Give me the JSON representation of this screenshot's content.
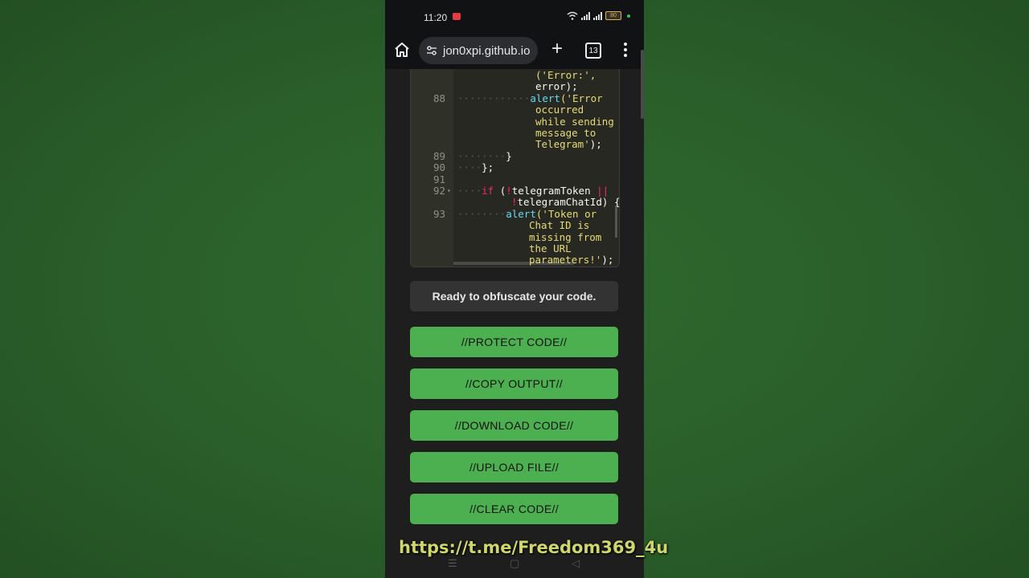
{
  "statusbar": {
    "time": "11:20",
    "battery": "80"
  },
  "browser": {
    "url": "jon0xpi.github.io",
    "tab_count": "13"
  },
  "editor": {
    "lines": [
      {
        "num": "",
        "dots": "",
        "segments": [
          {
            "cls": "str",
            "text": "('Error:',"
          }
        ]
      },
      {
        "num": "",
        "dots": "",
        "segments": [
          {
            "cls": "tx",
            "text": "error);"
          }
        ]
      },
      {
        "num": "88",
        "dots": "············",
        "segments": [
          {
            "cls": "fn",
            "text": "alert"
          },
          {
            "cls": "str",
            "text": "('Error"
          }
        ]
      },
      {
        "num": "",
        "dots": "",
        "segments": [
          {
            "cls": "str",
            "text": "occurred"
          }
        ]
      },
      {
        "num": "",
        "dots": "",
        "segments": [
          {
            "cls": "str",
            "text": "while sending"
          }
        ]
      },
      {
        "num": "",
        "dots": "",
        "segments": [
          {
            "cls": "str",
            "text": "message to"
          }
        ]
      },
      {
        "num": "",
        "dots": "",
        "segments": [
          {
            "cls": "str",
            "text": "Telegram'"
          },
          {
            "cls": "tx",
            "text": ");"
          }
        ]
      },
      {
        "num": "89",
        "dots": "········",
        "segments": [
          {
            "cls": "tx",
            "text": "}"
          }
        ]
      },
      {
        "num": "90",
        "dots": "····",
        "segments": [
          {
            "cls": "tx",
            "text": "};"
          }
        ]
      },
      {
        "num": "91",
        "dots": "",
        "segments": [
          {
            "cls": "tx",
            "text": ""
          }
        ]
      },
      {
        "num": "92",
        "dots": "····",
        "fold": "▾",
        "segments": [
          {
            "cls": "kw",
            "text": "if"
          },
          {
            "cls": "tx",
            "text": " ("
          },
          {
            "cls": "kw",
            "text": "!"
          },
          {
            "cls": "tx",
            "text": "telegramToken "
          },
          {
            "cls": "kw",
            "text": "||"
          }
        ]
      },
      {
        "num": "",
        "dots": "",
        "segments": [
          {
            "cls": "kw",
            "text": "!"
          },
          {
            "cls": "tx",
            "text": "telegramChatId) {"
          }
        ]
      },
      {
        "num": "93",
        "dots": "········",
        "segments": [
          {
            "cls": "fn",
            "text": "alert"
          },
          {
            "cls": "str",
            "text": "('Token or"
          }
        ]
      },
      {
        "num": "",
        "dots": "",
        "segments": [
          {
            "cls": "str",
            "text": "Chat ID is"
          }
        ]
      },
      {
        "num": "",
        "dots": "",
        "segments": [
          {
            "cls": "str",
            "text": "missing from"
          }
        ]
      },
      {
        "num": "",
        "dots": "",
        "segments": [
          {
            "cls": "str",
            "text": "the URL"
          }
        ]
      },
      {
        "num": "",
        "dots": "",
        "segments": [
          {
            "cls": "str",
            "text": "parameters!'"
          },
          {
            "cls": "tx",
            "text": ");"
          }
        ]
      }
    ]
  },
  "status_message": "Ready to obfuscate your code.",
  "buttons": {
    "protect": "//PROTECT CODE//",
    "copy": "//COPY OUTPUT//",
    "download": "//DOWNLOAD CODE//",
    "upload": "//UPLOAD FILE//",
    "clear": "//CLEAR CODE//"
  },
  "overlay_link": "https://t.me/Freedom369_4u",
  "colors": {
    "accent": "#4caf50",
    "background": "#1e1e1e"
  }
}
